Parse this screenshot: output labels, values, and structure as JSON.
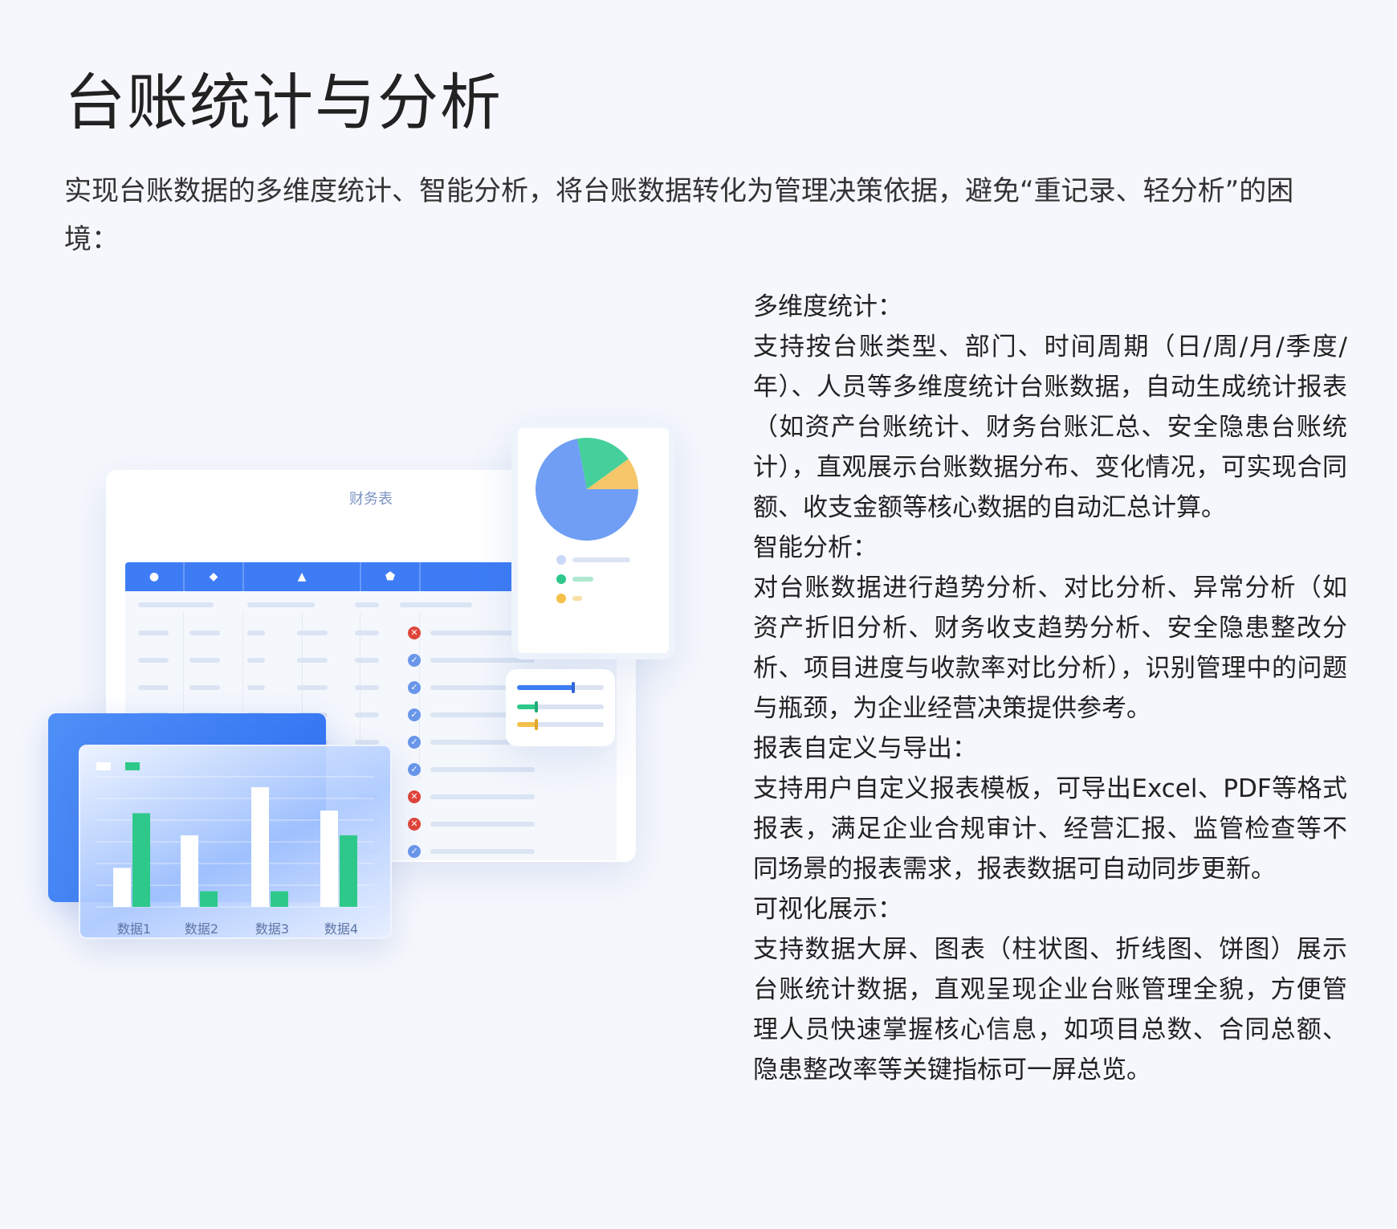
{
  "title": "台账统计与分析",
  "intro": "实现台账数据的多维度统计、智能分析，将台账数据转化为管理决策依据，避免“重记录、轻分析”的困境：",
  "features": [
    {
      "title": "多维度统计：",
      "desc": "支持按台账类型、部门、时间周期（日/周/月/季度/年）、人员等多维度统计台账数据，自动生成统计报表（如资产台账统计、财务台账汇总、安全隐患台账统计），直观展示台账数据分布、变化情况，可实现合同额、收支金额等核心数据的自动汇总计算。"
    },
    {
      "title": "智能分析：",
      "desc": "对台账数据进行趋势分析、对比分析、异常分析（如资产折旧分析、财务收支趋势分析、安全隐患整改分析、项目进度与收款率对比分析），识别管理中的问题与瓶颈，为企业经营决策提供参考。"
    },
    {
      "title": "报表自定义与导出：",
      "desc": "支持用户自定义报表模板，可导出Excel、PDF等格式报表，满足企业合规审计、经营汇报、监管检查等不同场景的报表需求，报表数据可自动同步更新。"
    },
    {
      "title": "可视化展示：",
      "desc": "支持数据大屏、图表（柱状图、折线图、饼图）展示台账统计数据，直观呈现企业台账管理全貌，方便管理人员快速掌握核心信息，如项目总数、合同总额、隐患整改率等关键指标可一屏总览。"
    }
  ],
  "illustration": {
    "table_title": "财务表",
    "header_symbols": [
      "●",
      "◆",
      "▲",
      "⬟"
    ],
    "row_status": [
      "bad",
      "ok",
      "ok",
      "ok",
      "ok",
      "ok",
      "bad",
      "bad",
      "ok"
    ],
    "colors": {
      "primary": "#3d7cf5",
      "green": "#2ec98a",
      "yellow": "#f5c04a",
      "light_blue": "#c9d8f6",
      "red": "#e0443a"
    }
  },
  "chart_data": [
    {
      "type": "bar",
      "categories": [
        "数据1",
        "数据2",
        "数据3",
        "数据4"
      ],
      "series": [
        {
          "values": [
            30,
            55,
            92,
            74
          ]
        },
        {
          "values": [
            72,
            12,
            12,
            55
          ]
        }
      ],
      "ylim": [
        0,
        100
      ],
      "colors": [
        "#ffffff",
        "#2ec98a"
      ],
      "grid": true
    },
    {
      "type": "pie",
      "values": [
        72,
        18,
        10
      ],
      "colors": [
        "#6f9ef4",
        "#45d09b",
        "#f5c66a"
      ]
    }
  ]
}
